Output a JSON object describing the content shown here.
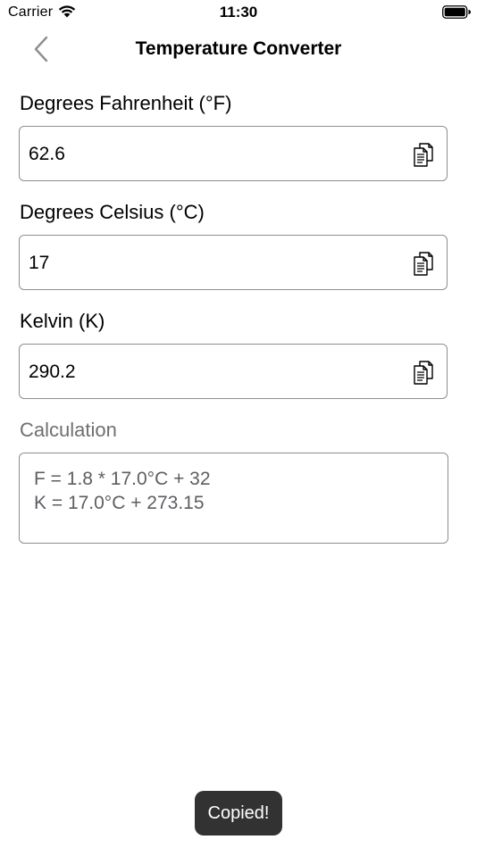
{
  "status_bar": {
    "carrier": "Carrier",
    "time": "11:30"
  },
  "nav": {
    "title": "Temperature Converter",
    "back_icon": "chevron-left-icon"
  },
  "fields": [
    {
      "label": "Degrees Fahrenheit (°F)",
      "value": "62.6",
      "copy_icon": "copy-icon"
    },
    {
      "label": "Degrees Celsius (°C)",
      "value": "17",
      "copy_icon": "copy-icon"
    },
    {
      "label": "Kelvin (K)",
      "value": "290.2",
      "copy_icon": "copy-icon"
    }
  ],
  "calculation": {
    "label": "Calculation",
    "lines": [
      "F = 1.8 * 17.0°C + 32",
      "K = 17.0°C + 273.15"
    ]
  },
  "toast": {
    "text": "Copied!"
  },
  "colors": {
    "accent_gray": "#8e8e93",
    "toast_bg": "#323232"
  }
}
